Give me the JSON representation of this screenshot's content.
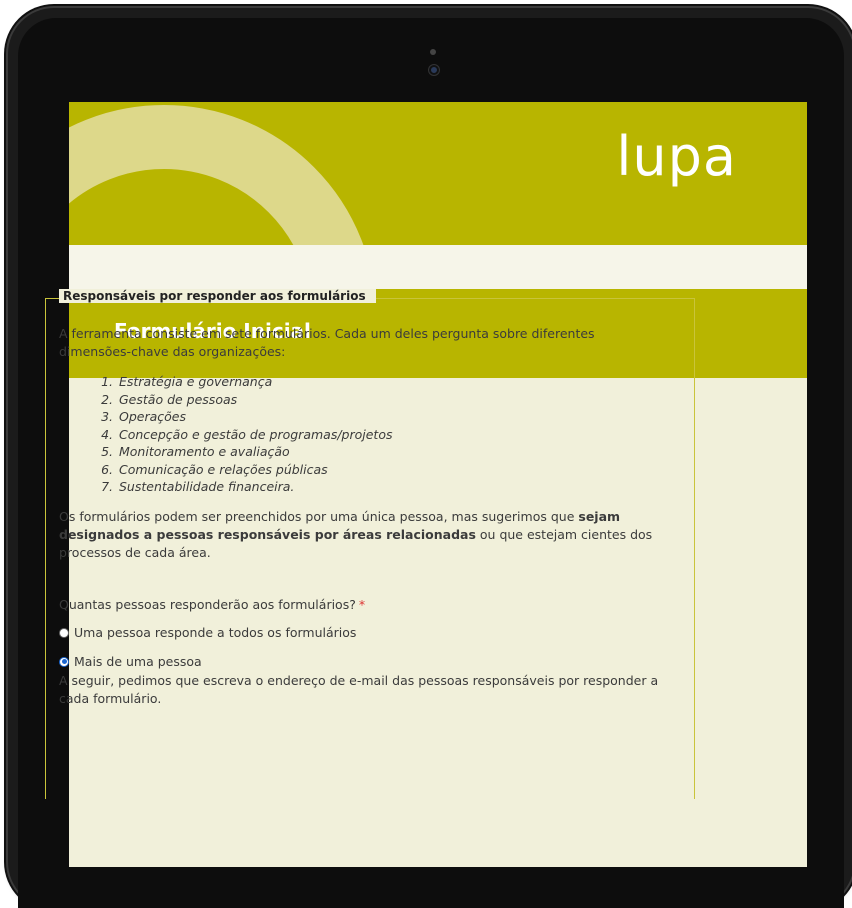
{
  "brand": {
    "logo_text": "lupa",
    "accent_color": "#b8b500",
    "bg_color": "#f1f0da"
  },
  "form": {
    "title": "Formulário Inicial",
    "section": {
      "legend": "Responsáveis por responder aos formulários",
      "intro": "A ferramenta consiste em sete formulários. Cada um deles pergunta sobre diferentes dimensões-chave das organizações:",
      "dimensions": [
        "Estratégia e governança",
        "Gestão de pessoas",
        "Operações",
        "Concepção e gestão de programas/projetos",
        "Monitoramento e avaliação",
        "Comunicação e relações públicas",
        "Sustentabilidade financeira."
      ],
      "note_before": "Os formulários podem ser preenchidos por uma única pessoa, mas sugerimos que ",
      "note_bold": "sejam designados a pessoas responsáveis por áreas relacionadas",
      "note_after": " ou que estejam cientes dos processos de cada área.",
      "question": "Quantas pessoas responderão aos formulários?",
      "required_mark": "*",
      "options": [
        {
          "label": "Uma pessoa responde a todos os formulários",
          "selected": false
        },
        {
          "label": "Mais de uma pessoa",
          "selected": true
        }
      ],
      "followup": "A seguir, pedimos que escreva o endereço de e-mail das pessoas responsáveis por responder a cada formulário."
    }
  }
}
